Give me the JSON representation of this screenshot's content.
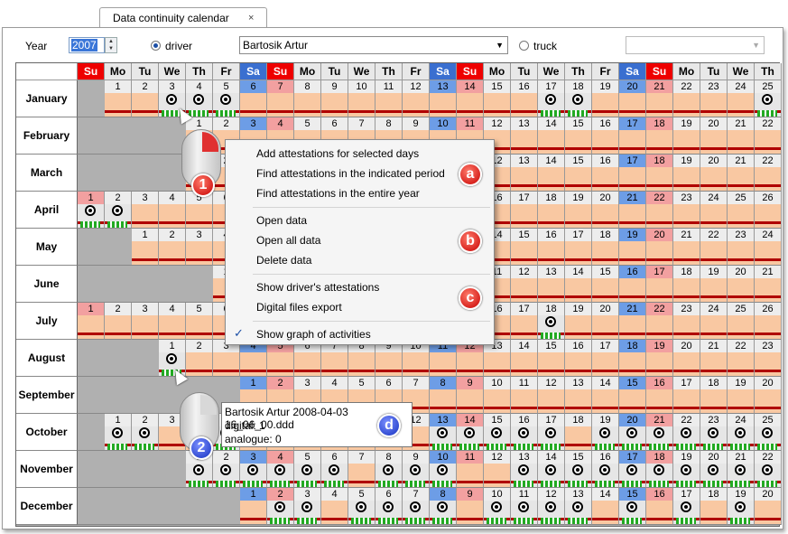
{
  "tab": {
    "title": "Data continuity calendar",
    "close": "×"
  },
  "toolbar": {
    "year_label": "Year",
    "year_value": "2007",
    "driver_label": "driver",
    "driver_selected": true,
    "driver_value": "Bartosik Artur",
    "truck_label": "truck",
    "truck_selected": false,
    "truck_value": ""
  },
  "header_days": [
    "Su",
    "Mo",
    "Tu",
    "We",
    "Th",
    "Fr",
    "Sa",
    "Su",
    "Mo",
    "Tu",
    "We",
    "Th",
    "Fr",
    "Sa",
    "Su",
    "Mo",
    "Tu",
    "We",
    "Th",
    "Fr",
    "Sa",
    "Su",
    "Mo",
    "Tu",
    "We",
    "Th"
  ],
  "months": [
    {
      "name": "January",
      "start": 1,
      "days": 25,
      "att": [
        3,
        4,
        5,
        17,
        18,
        25
      ]
    },
    {
      "name": "February",
      "start": 4,
      "days": 22,
      "att": [
        24,
        25
      ]
    },
    {
      "name": "March",
      "start": 4,
      "days": 22,
      "att": []
    },
    {
      "name": "April",
      "start": 0,
      "days": 26,
      "att": [
        1,
        2
      ]
    },
    {
      "name": "May",
      "start": 2,
      "days": 24,
      "att": []
    },
    {
      "name": "June",
      "start": 5,
      "days": 21,
      "att": []
    },
    {
      "name": "July",
      "start": 0,
      "days": 26,
      "att": [
        18
      ]
    },
    {
      "name": "August",
      "start": 3,
      "days": 23,
      "att": [
        1
      ]
    },
    {
      "name": "September",
      "start": 6,
      "days": 20,
      "att": []
    },
    {
      "name": "October",
      "start": 1,
      "days": 25,
      "att": [
        1,
        2,
        5,
        13,
        14,
        15,
        16,
        17,
        19,
        20,
        21,
        22,
        23,
        24,
        25
      ]
    },
    {
      "name": "November",
      "start": 4,
      "days": 22,
      "att": [
        1,
        2,
        3,
        4,
        5,
        6,
        8,
        9,
        10,
        13,
        14,
        15,
        16,
        17,
        18,
        19,
        20,
        21,
        22,
        23
      ]
    },
    {
      "name": "December",
      "start": 6,
      "days": 20,
      "att": [
        2,
        3,
        5,
        6,
        7,
        8,
        10,
        11,
        12,
        13,
        15,
        17,
        19
      ]
    }
  ],
  "menu": {
    "items": [
      "Add attestations for selected days",
      "Find attestations in the indicated period",
      "Find attestations in the entire year",
      "Open data",
      "Open all data",
      "Delete data",
      "Show driver's attestations",
      "Digital files export",
      "Show graph of activities"
    ],
    "check": "✓"
  },
  "tooltip": {
    "line1": "Bartosik Artur 2008-04-03 16_06_00.ddd",
    "line2": "digital: 1",
    "line3": "analogue: 0"
  },
  "badges": {
    "a": "a",
    "b": "b",
    "c": "c",
    "d": "d",
    "one": "1",
    "two": "2"
  }
}
